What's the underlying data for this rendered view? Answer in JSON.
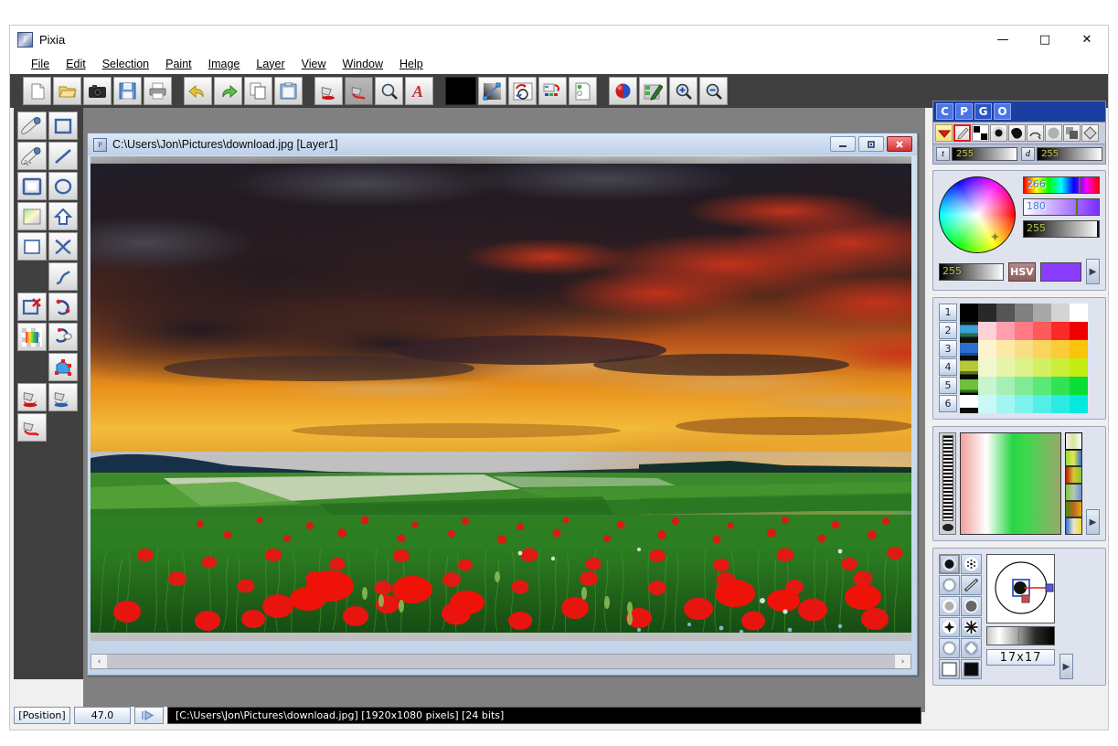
{
  "app": {
    "title": "Pixia",
    "icon": "pixia-app-icon"
  },
  "window_controls": {
    "minimize": "—",
    "maximize": "□",
    "close": "✕"
  },
  "menu": [
    {
      "label": "File"
    },
    {
      "label": "Edit"
    },
    {
      "label": "Selection"
    },
    {
      "label": "Paint"
    },
    {
      "label": "Image"
    },
    {
      "label": "Layer"
    },
    {
      "label": "View"
    },
    {
      "label": "Window"
    },
    {
      "label": "Help"
    }
  ],
  "toolbar": {
    "groups": [
      {
        "buttons": [
          {
            "name": "new-file-button",
            "icon": "new-document-icon",
            "active": false
          },
          {
            "name": "open-file-button",
            "icon": "open-folder-icon",
            "active": false
          },
          {
            "name": "capture-button",
            "icon": "camera-icon",
            "active": false
          },
          {
            "name": "save-button",
            "icon": "floppy-disk-icon",
            "active": false
          },
          {
            "name": "print-button",
            "icon": "printer-icon",
            "active": false
          }
        ]
      },
      {
        "buttons": [
          {
            "name": "undo-button",
            "icon": "undo-arrow-icon",
            "active": false
          },
          {
            "name": "redo-button",
            "icon": "redo-arrow-icon",
            "active": false
          },
          {
            "name": "copy-button",
            "icon": "copy-pages-icon",
            "active": false
          },
          {
            "name": "paste-button",
            "icon": "clipboard-icon",
            "active": false
          }
        ]
      },
      {
        "buttons": [
          {
            "name": "fill-bucket-button",
            "icon": "paint-bucket-icon",
            "active": false
          },
          {
            "name": "line-fill-button",
            "icon": "paint-pour-icon",
            "active": true
          },
          {
            "name": "zoom-tool-button",
            "icon": "magnifier-icon",
            "active": false
          },
          {
            "name": "text-tool-button",
            "icon": "text-a-icon",
            "active": false
          }
        ]
      },
      {
        "buttons": [
          {
            "name": "foreground-color-button",
            "icon": "black-color-swatch",
            "active": false
          },
          {
            "name": "tone-curve-button",
            "icon": "tone-curve-icon",
            "active": false
          },
          {
            "name": "transform-button",
            "icon": "rotate-transform-icon",
            "active": false
          },
          {
            "name": "layer-merge-button",
            "icon": "layer-merge-icon",
            "active": false
          },
          {
            "name": "layer-list-button",
            "icon": "layer-list-icon",
            "active": false
          }
        ]
      },
      {
        "buttons": [
          {
            "name": "color-balance-button",
            "icon": "sphere-color-icon",
            "active": false
          },
          {
            "name": "edit-mask-button",
            "icon": "mask-edit-icon",
            "active": false
          },
          {
            "name": "zoom-in-button",
            "icon": "magnifier-plus-icon",
            "active": false
          },
          {
            "name": "zoom-out-button",
            "icon": "magnifier-minus-icon",
            "active": false
          }
        ]
      }
    ]
  },
  "tool_palette": {
    "column1": [
      {
        "name": "tool-pen-soft",
        "icon": "pen-nib-icon",
        "active": false
      },
      {
        "name": "tool-pen-textured",
        "icon": "pen-nib-dotted-icon",
        "active": false
      },
      {
        "name": "tool-rect-fill",
        "icon": "filled-rectangle-icon",
        "active": false
      },
      {
        "name": "tool-gradient",
        "icon": "gradient-square-icon",
        "active": false
      },
      {
        "name": "tool-rect-outline",
        "icon": "outline-rectangle-icon",
        "active": false
      },
      {
        "name": "tool-spacer",
        "icon": "",
        "active": false
      },
      {
        "name": "tool-deselect",
        "icon": "rectangle-with-x-icon",
        "active": false
      },
      {
        "name": "tool-color-select",
        "icon": "checker-color-icon",
        "active": false
      },
      {
        "name": "tool-spacer-2",
        "icon": "",
        "active": false
      },
      {
        "name": "tool-bucket-red",
        "icon": "paint-bucket-red-icon",
        "active": false
      },
      {
        "name": "tool-pour-red",
        "icon": "paint-pour-red-icon",
        "active": false
      }
    ],
    "column2": [
      {
        "name": "tool-rect-select",
        "icon": "rectangle-select-icon",
        "active": false
      },
      {
        "name": "tool-line",
        "icon": "line-icon",
        "active": false
      },
      {
        "name": "tool-ellipse",
        "icon": "ellipse-icon",
        "active": false
      },
      {
        "name": "tool-polygon",
        "icon": "polygon-arrow-icon",
        "active": false
      },
      {
        "name": "tool-cross-select",
        "icon": "cross-x-icon",
        "active": false
      },
      {
        "name": "tool-curve",
        "icon": "bezier-curve-icon",
        "active": false
      },
      {
        "name": "tool-magnet-curve",
        "icon": "magnet-curve-icon",
        "active": false
      },
      {
        "name": "tool-lasso-pen",
        "icon": "lasso-pen-icon",
        "active": false
      },
      {
        "name": "tool-path-fill",
        "icon": "path-node-fill-icon",
        "active": false
      },
      {
        "name": "tool-bucket-blue",
        "icon": "paint-bucket-blue-icon",
        "active": false
      }
    ]
  },
  "document": {
    "title": "C:\\Users\\Jon\\Pictures\\download.jpg [Layer1]",
    "icon": "document-icon",
    "controls": {
      "minimize": "–",
      "restore": "▣",
      "close": "✕"
    },
    "scrollbar": {
      "left_arrow": "‹",
      "right_arrow": "›"
    },
    "image_description": "poppy-field-sunset-photo"
  },
  "statusbar": {
    "position_label": "[Position]",
    "zoom_value": "47.0",
    "play_icon": "play-triangle-icon",
    "info": "[C:\\Users\\Jon\\Pictures\\download.jpg] [1920x1080 pixels] [24 bits]"
  },
  "color_panel": {
    "tabs": [
      {
        "label": "C",
        "selected": true
      },
      {
        "label": "P",
        "selected": true
      },
      {
        "label": "G",
        "selected": false
      },
      {
        "label": "O",
        "selected": true
      }
    ],
    "mode_buttons": [
      {
        "name": "mode-dropdown",
        "icon": "red-triangle-down-icon",
        "style": "yellow"
      },
      {
        "name": "mode-pencil",
        "icon": "pencil-icon",
        "style": "red-outline"
      },
      {
        "name": "mode-checker",
        "icon": "checker-icon",
        "style": "plain"
      },
      {
        "name": "mode-radial",
        "icon": "radial-blob-icon",
        "style": "plain"
      },
      {
        "name": "mode-blob",
        "icon": "blob-icon",
        "style": "plain"
      },
      {
        "name": "mode-arc",
        "icon": "arc-icon",
        "style": "plain"
      },
      {
        "name": "mode-circle",
        "icon": "gray-circle-icon",
        "style": "plain"
      },
      {
        "name": "mode-layers",
        "icon": "layers-icon",
        "style": "plain"
      },
      {
        "name": "mode-diamond",
        "icon": "diamond-icon",
        "style": "plain"
      }
    ],
    "tone": {
      "label": "t",
      "value": "255"
    },
    "density": {
      "label": "d",
      "value": "255"
    },
    "wheel": {
      "name": "color-wheel",
      "cursor": "✦"
    },
    "hue": {
      "value": "266"
    },
    "saturation": {
      "value": "180"
    },
    "brightness": {
      "value": "255"
    },
    "alpha": {
      "value": "255"
    },
    "model": {
      "label": "HSV",
      "swatch_color": "#8a3dff"
    },
    "expand_arrow": "▶"
  },
  "palette_panel": {
    "rows": [
      {
        "number": "1",
        "thumb": "none",
        "colors": [
          "#000000",
          "#282828",
          "#555555",
          "#808080",
          "#a8a8a8",
          "#d4d4d4",
          "#ffffff"
        ]
      },
      {
        "number": "2",
        "thumb": "sky-thumb",
        "colors": [
          "#ffd0d8",
          "#ff9fae",
          "#ff7a85",
          "#ff5a5a",
          "#fa2a28",
          "#f00000"
        ]
      },
      {
        "number": "3",
        "thumb": "blue-thumb",
        "colors": [
          "#fdf4cf",
          "#fbe9a8",
          "#fade85",
          "#fad45e",
          "#fbcb38",
          "#fbc40a"
        ]
      },
      {
        "number": "4",
        "thumb": "rapeseed-thumb",
        "colors": [
          "#f0f7cd",
          "#e6f5a9",
          "#dcf288",
          "#d2f05f",
          "#cbee39",
          "#c3ec12"
        ]
      },
      {
        "number": "5",
        "thumb": "grass-thumb",
        "colors": [
          "#c8f5cf",
          "#a6efb4",
          "#80eb95",
          "#5ae876",
          "#30e356",
          "#0ade35"
        ]
      },
      {
        "number": "6",
        "thumb": "leaf-thumb",
        "colors": [
          "#c9f8f6",
          "#a3f5f1",
          "#7cf2ec",
          "#53eee7",
          "#2aebe2",
          "#05e8dd"
        ]
      }
    ]
  },
  "gradient_panel": {
    "slider_name": "gradient-intensity-slider",
    "main_name": "gradient-preview",
    "presets": [
      "preset-white-green",
      "preset-green-blue",
      "preset-red-green",
      "preset-green-blue-2",
      "preset-green-orange",
      "preset-blue-white"
    ],
    "expand_arrow": "▶"
  },
  "brush_panel": {
    "brushes": [
      {
        "name": "brush-hard-round",
        "icon": "hard-round-icon",
        "selected": true
      },
      {
        "name": "brush-spray-dotted",
        "icon": "spray-dotted-icon",
        "selected": false
      },
      {
        "name": "brush-soft-round",
        "icon": "soft-round-icon",
        "selected": false
      },
      {
        "name": "brush-diagonal-line",
        "icon": "diagonal-line-icon",
        "selected": false
      },
      {
        "name": "brush-halftone-fine",
        "icon": "halftone-fine-icon",
        "selected": false
      },
      {
        "name": "brush-halftone-coarse",
        "icon": "halftone-coarse-icon",
        "selected": false
      },
      {
        "name": "brush-star-4",
        "icon": "star-4-icon",
        "selected": false
      },
      {
        "name": "brush-star-8",
        "icon": "star-8-icon",
        "selected": false
      },
      {
        "name": "brush-circle-outline",
        "icon": "circle-outline-icon",
        "selected": false
      },
      {
        "name": "brush-diamond-outline",
        "icon": "diamond-outline-icon",
        "selected": false
      },
      {
        "name": "brush-square-white",
        "icon": "square-white-icon",
        "selected": false
      },
      {
        "name": "brush-square-black",
        "icon": "square-black-icon",
        "selected": false
      }
    ],
    "size_label": "17x17",
    "preview_name": "brush-shape-preview",
    "curve_name": "brush-falloff-curve",
    "expand_arrow": "▶"
  }
}
